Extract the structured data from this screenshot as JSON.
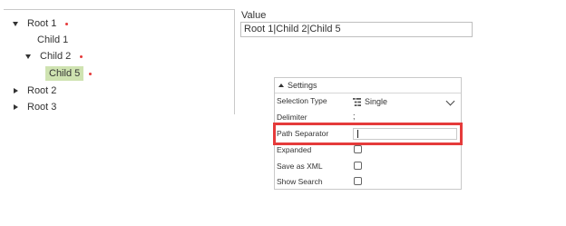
{
  "tree": {
    "root1": {
      "label": "Root 1",
      "expanded": true
    },
    "child1": {
      "label": "Child 1"
    },
    "child2": {
      "label": "Child 2",
      "expanded": true
    },
    "child5": {
      "label": "Child 5",
      "selected": true
    },
    "root2": {
      "label": "Root 2",
      "expanded": false
    },
    "root3": {
      "label": "Root 3",
      "expanded": false
    },
    "dot_color": "#e53b3b",
    "selection_color": "#cfe3b1"
  },
  "value": {
    "label": "Value",
    "text": "Root 1|Child 2|Child 5"
  },
  "settings": {
    "header": "Settings",
    "rows": {
      "selection_type": {
        "label": "Selection Type",
        "value": "Single"
      },
      "delimiter": {
        "label": "Delimiter",
        "value": ";"
      },
      "path_separator": {
        "label": "Path Separator",
        "value": "|"
      },
      "expanded": {
        "label": "Expanded",
        "checked": false
      },
      "save_as_xml": {
        "label": "Save as XML",
        "checked": false
      },
      "show_search": {
        "label": "Show Search",
        "checked": false
      }
    }
  },
  "highlight_color": "#e53b3b"
}
